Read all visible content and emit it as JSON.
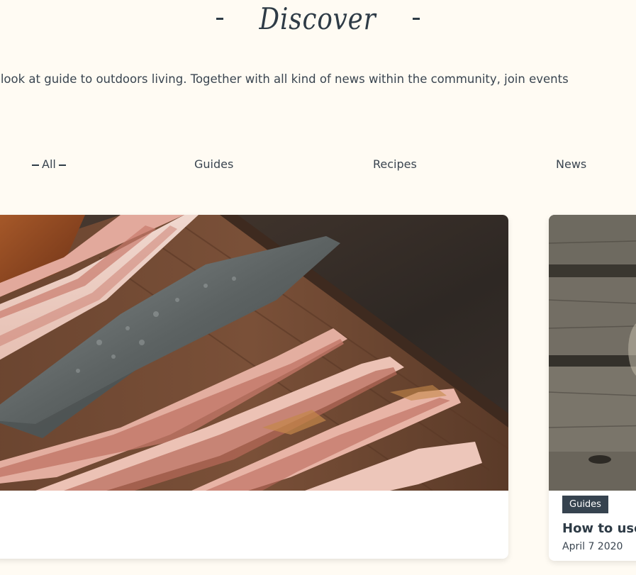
{
  "header": {
    "dash": "-",
    "title": "Discover"
  },
  "intro": {
    "text": "Search for recipes and look at guide to outdoors living. Together with all kind of news within the community, join events"
  },
  "filters": {
    "items": [
      {
        "label": "All",
        "active": true
      },
      {
        "label": "Guides",
        "active": false
      },
      {
        "label": "Recipes",
        "active": false
      },
      {
        "label": "News",
        "active": false
      }
    ]
  },
  "cards": [
    {
      "image": "bacon-and-knife-photo",
      "tag": "",
      "title": "",
      "date": ""
    },
    {
      "image": "wood-grill-photo",
      "tag": "Guides",
      "title": "How to use",
      "date": "April 7 2020"
    }
  ],
  "colors": {
    "background": "#fffbf3",
    "text": "#2e3b46",
    "tag_bg": "#36434f"
  }
}
